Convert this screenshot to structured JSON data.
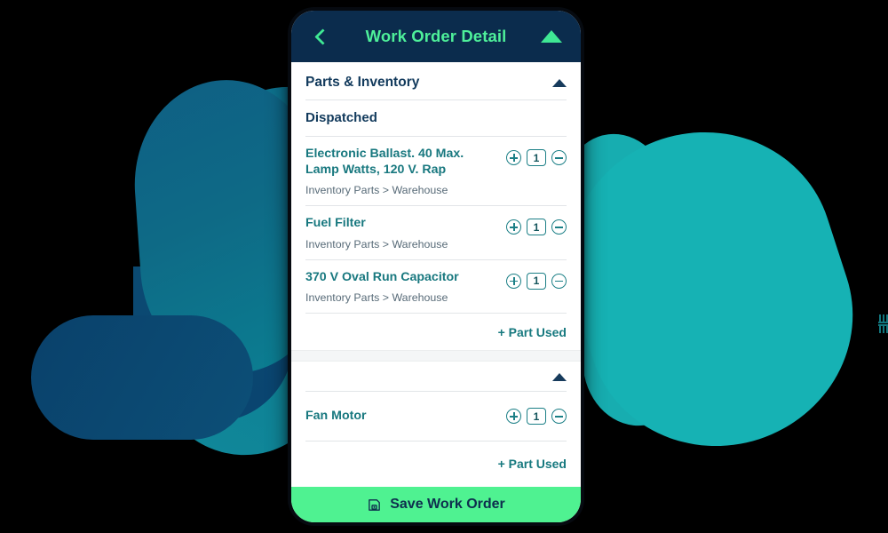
{
  "app": {
    "header": {
      "back_icon": "chevron-left-icon",
      "title": "Work Order Detail",
      "collapse_icon": "triangle-up-icon"
    },
    "colors": {
      "header_bg": "#0b2c4d",
      "accent_green": "#3fe894",
      "accent_teal": "#18787f",
      "save_bar_bg": "#4ff291",
      "navy_text": "#123a5c",
      "muted_text": "#586b78",
      "blob_teal": "#16b2b4",
      "blob_blue": "#0a416b"
    }
  },
  "sections": [
    {
      "title": "Parts & Inventory",
      "collapse_icon": "triangle-up-icon",
      "subheader": "Dispatched",
      "parts": [
        {
          "name": "Electronic Ballast. 40 Max. Lamp Watts, 120 V. Rap",
          "path": "Inventory Parts > Warehouse",
          "qty": "1",
          "increment_icon": "plus-circle-icon",
          "decrement_icon": "minus-circle-icon"
        },
        {
          "name": "Fuel Filter",
          "path": "Inventory Parts > Warehouse",
          "qty": "1",
          "increment_icon": "plus-circle-icon",
          "decrement_icon": "minus-circle-icon"
        },
        {
          "name": "370 V Oval Run Capacitor",
          "path": "Inventory Parts > Warehouse",
          "qty": "1",
          "increment_icon": "plus-circle-icon",
          "decrement_icon": "minus-circle-icon"
        }
      ],
      "add_part_label": "+ Part Used"
    },
    {
      "title": "",
      "collapse_icon": "triangle-up-icon",
      "parts": [
        {
          "name": "Fan Motor",
          "path": "",
          "qty": "1",
          "increment_icon": "plus-circle-icon",
          "decrement_icon": "minus-circle-icon"
        }
      ],
      "add_part_label": "+ Part Used"
    }
  ],
  "handle": {
    "icon": "drag-handle-icon"
  },
  "footer": {
    "save_icon": "floppy-disk-icon",
    "save_label": "Save Work Order"
  }
}
